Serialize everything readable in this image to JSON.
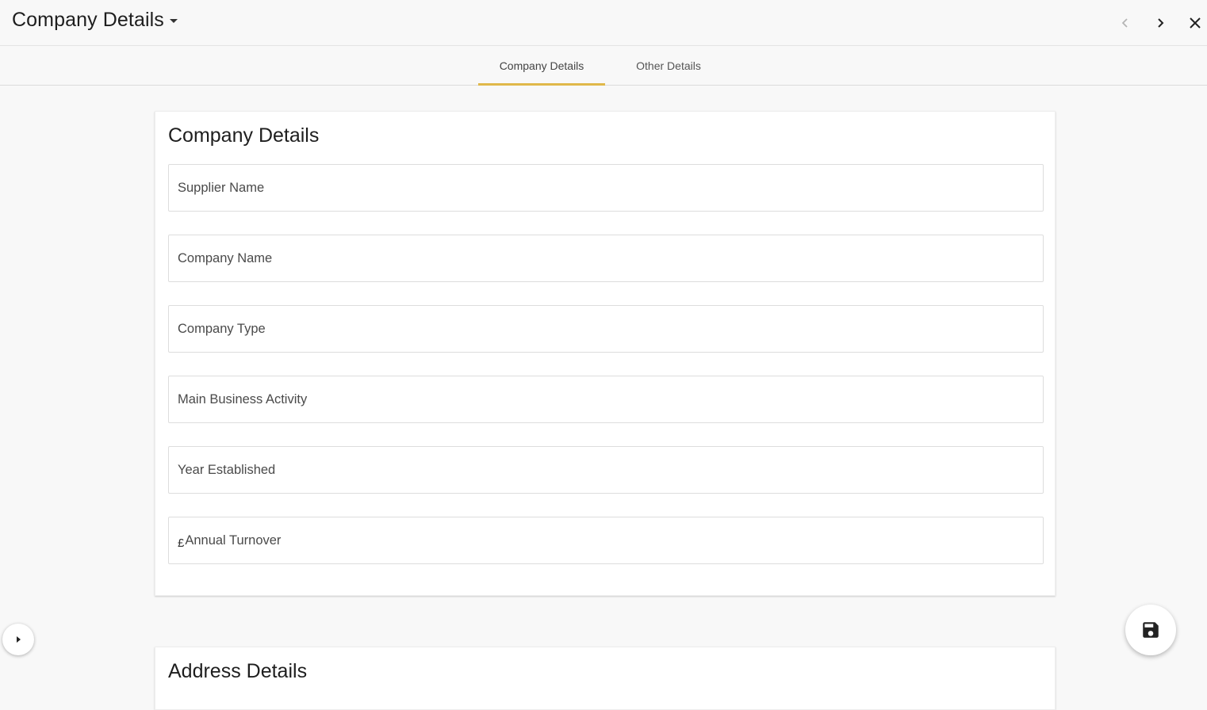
{
  "header": {
    "title": "Company Details",
    "prev_icon": "chevron-left-icon",
    "next_icon": "chevron-right-icon",
    "close_icon": "close-icon"
  },
  "tabs": [
    {
      "label": "Company Details",
      "active": true
    },
    {
      "label": "Other Details",
      "active": false
    }
  ],
  "company_section": {
    "title": "Company Details",
    "fields": [
      {
        "label": "Supplier Name",
        "value": ""
      },
      {
        "label": "Company Name",
        "value": ""
      },
      {
        "label": "Company Type",
        "value": ""
      },
      {
        "label": "Main Business Activity",
        "value": ""
      },
      {
        "label": "Year Established",
        "value": ""
      },
      {
        "label": "Annual Turnover",
        "prefix": "£",
        "value": ""
      }
    ]
  },
  "address_section": {
    "title": "Address Details"
  },
  "colors": {
    "tab_indicator": "#e0b84a",
    "background": "#f8f8f8"
  }
}
